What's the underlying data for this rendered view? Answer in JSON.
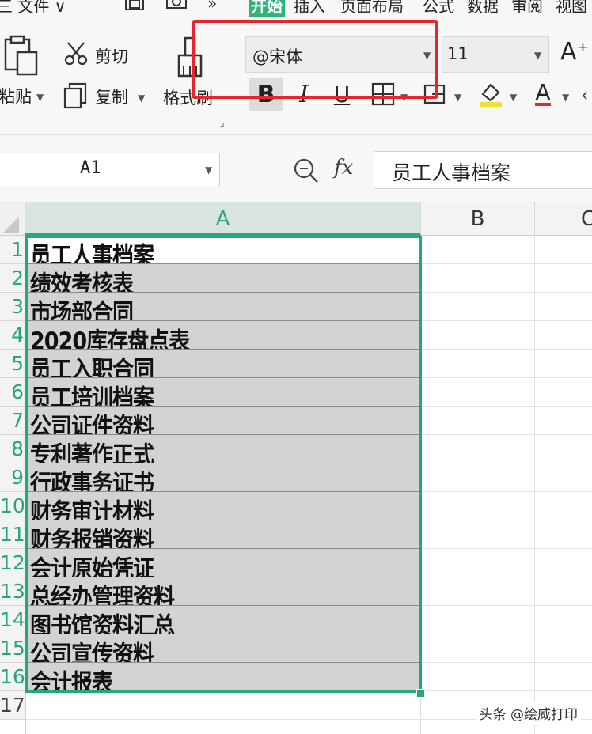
{
  "menu": {
    "file": "三 文件 ∨",
    "more": "»",
    "tabs": [
      "开始",
      "插入",
      "页面布局",
      "公式",
      "数据",
      "审阅",
      "视图"
    ]
  },
  "clipboard": {
    "paste": "粘贴",
    "cut": "剪切",
    "copy": "复制",
    "format_painter": "格式刷"
  },
  "font": {
    "name": "@宋体",
    "size": "11",
    "bold": "B",
    "italic": "I",
    "underline": "U",
    "grow": "A⁺",
    "font_color_letter": "A"
  },
  "formula_bar": {
    "cell_ref": "A1",
    "fx": "fx",
    "content": "员工人事档案"
  },
  "columns": [
    "A",
    "B",
    "C"
  ],
  "rows": [
    {
      "num": "1",
      "text": "员工人事档案"
    },
    {
      "num": "2",
      "text": "绩效考核表"
    },
    {
      "num": "3",
      "text": "市场部合同"
    },
    {
      "num": "4",
      "text": "2020库存盘点表"
    },
    {
      "num": "5",
      "text": "员工入职合同"
    },
    {
      "num": "6",
      "text": "员工培训档案"
    },
    {
      "num": "7",
      "text": "公司证件资料"
    },
    {
      "num": "8",
      "text": "专利著作正式"
    },
    {
      "num": "9",
      "text": "行政事务证书"
    },
    {
      "num": "10",
      "text": "财务审计材料"
    },
    {
      "num": "11",
      "text": "财务报销资料"
    },
    {
      "num": "12",
      "text": "会计原始凭证"
    },
    {
      "num": "13",
      "text": "总经办管理资料"
    },
    {
      "num": "14",
      "text": "图书馆资料汇总"
    },
    {
      "num": "15",
      "text": "公司宣传资料"
    },
    {
      "num": "16",
      "text": "会计报表"
    },
    {
      "num": "17",
      "text": ""
    }
  ],
  "watermark": "头条 @绘威打印",
  "colors": {
    "accent": "#2aa876",
    "highlight": "#e5262e",
    "font_color_bar": "#e0262e",
    "fill_color_bar": "#f2e03a"
  }
}
